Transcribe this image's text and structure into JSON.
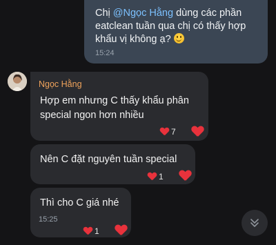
{
  "outgoing": {
    "prefix": "Chị ",
    "mention": "@Ngọc Hằng",
    "text": "  dùng các phần eatclean tuần qua chị có thấy hợp khẩu vị không ạ?",
    "emoji": "smile-emoji",
    "time": "15:24"
  },
  "sender": {
    "name": "Ngọc Hằng",
    "avatar": "avatar-photo"
  },
  "messages": [
    {
      "text": "Hợp em nhưng C thấy khẩu phân special ngon hơn nhiều",
      "reaction_count": "7"
    },
    {
      "text": "Nên C đặt nguyên tuần special",
      "reaction_count": "1"
    },
    {
      "text": "Thì cho C giá nhé",
      "time": "15:25",
      "reaction_count": "1"
    }
  ],
  "colors": {
    "background": "#141416",
    "outgoing_bubble": "#3b4654",
    "incoming_bubble": "#2a2b2f",
    "mention": "#7cc1ff",
    "sender_name": "#f0a35b",
    "heart": "#e8323c"
  },
  "icons": {
    "reaction": "heart-icon",
    "scroll": "chevron-double-down-icon"
  }
}
